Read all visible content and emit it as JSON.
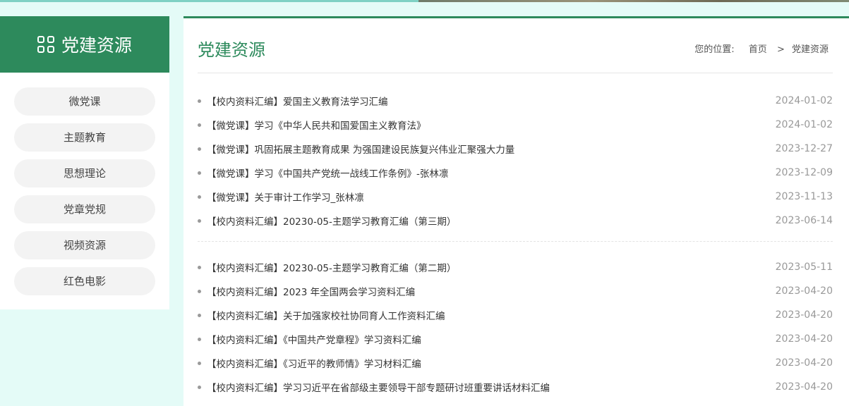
{
  "sidebar": {
    "title": "党建资源",
    "icon": "grid-icon",
    "items": [
      {
        "label": "微党课"
      },
      {
        "label": "主题教育"
      },
      {
        "label": "思想理论"
      },
      {
        "label": "党章党规"
      },
      {
        "label": "视频资源"
      },
      {
        "label": "红色电影"
      }
    ]
  },
  "main": {
    "title": "党建资源",
    "breadcrumb": {
      "label": "您的位置:",
      "home": "首页",
      "separator": ">",
      "current": "党建资源"
    },
    "list_a": [
      {
        "title": "【校内资料汇编】爱国主义教育法学习汇编",
        "date": "2024-01-02"
      },
      {
        "title": "【微党课】学习《中华人民共和国爱国主义教育法》",
        "date": "2024-01-02"
      },
      {
        "title": "【微党课】巩固拓展主题教育成果 为强国建设民族复兴伟业汇聚强大力量",
        "date": "2023-12-27"
      },
      {
        "title": "【微党课】学习《中国共产党统一战线工作条例》-张林凛",
        "date": "2023-12-09"
      },
      {
        "title": "【微党课】关于审计工作学习_张林凛",
        "date": "2023-11-13"
      },
      {
        "title": "【校内资料汇编】20230-05-主题学习教育汇编（第三期）",
        "date": "2023-06-14"
      }
    ],
    "list_b": [
      {
        "title": "【校内资料汇编】20230-05-主题学习教育汇编（第二期）",
        "date": "2023-05-11"
      },
      {
        "title": "【校内资料汇编】2023 年全国两会学习资料汇编",
        "date": "2023-04-20"
      },
      {
        "title": "【校内资料汇编】关于加强家校社协同育人工作资料汇编",
        "date": "2023-04-20"
      },
      {
        "title": "【校内资料汇编】《中国共产党章程》学习资料汇编",
        "date": "2023-04-20"
      },
      {
        "title": "【校内资料汇编】《习近平的教师情》学习材料汇编",
        "date": "2023-04-20"
      },
      {
        "title": "【校内资料汇编】学习习近平在省部级主要领导干部专题研讨班重要讲话材料汇编",
        "date": "2023-04-20"
      }
    ]
  },
  "colors": {
    "brand_green": "#2d8a5c",
    "page_background": "#e4fbf7"
  }
}
